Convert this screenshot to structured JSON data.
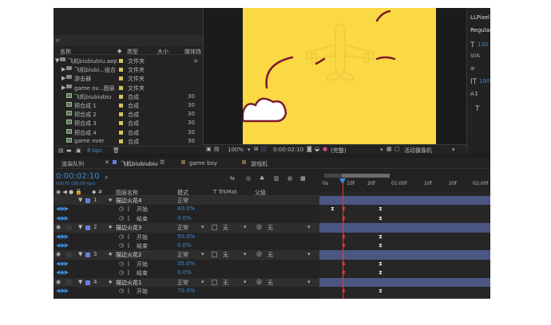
{
  "project": {
    "columns": {
      "name": "名称",
      "type": "类型",
      "size": "大小",
      "media_duration": "媒体持"
    },
    "items": [
      {
        "name": "飞机biubiubiu.aep",
        "type": "文件夹",
        "kind": "folder",
        "expanded": true
      },
      {
        "name": "飞机biubi...组合",
        "type": "文件夹",
        "kind": "folder"
      },
      {
        "name": "游击器",
        "type": "文件夹",
        "kind": "folder"
      },
      {
        "name": "game ov...图层",
        "type": "文件夹",
        "kind": "folder"
      },
      {
        "name": "飞机biubiubiu",
        "type": "合成",
        "kind": "comp",
        "duration": "30"
      },
      {
        "name": "预合成 1",
        "type": "合成",
        "kind": "comp",
        "duration": "30"
      },
      {
        "name": "预合成 2",
        "type": "合成",
        "kind": "comp",
        "duration": "30"
      },
      {
        "name": "预合成 3",
        "type": "合成",
        "kind": "comp",
        "duration": "30"
      },
      {
        "name": "预合成 4",
        "type": "合成",
        "kind": "comp",
        "duration": "30"
      },
      {
        "name": "game over",
        "type": "合成",
        "kind": "comp",
        "duration": "30"
      }
    ],
    "bpc": "8 bpc"
  },
  "viewer": {
    "zoom": "100%",
    "timecode": "0:00:02:10",
    "resolution": "(完整)",
    "camera": "活动摄像机"
  },
  "right_panel": {
    "font": "LLPixel",
    "style": "Regular",
    "size": "130",
    "leading": "100"
  },
  "tabs": {
    "render_queue": "渲染队列",
    "comp1": "飞机biubiubiu",
    "comp2": "game boy",
    "comp3": "游戏机"
  },
  "timeline": {
    "timecode": "0:00:02:10",
    "frames": "00070 (30.00 fps)",
    "columns": {
      "layer_name": "图层名称",
      "mode": "模式",
      "trkmat": "T  TrkMat",
      "parent": "父级"
    },
    "ruler": [
      "0s",
      "10f",
      "20f",
      "01:00f",
      "10f",
      "20f",
      "02:00f"
    ],
    "rows": [
      {
        "kind": "layer",
        "num": "1",
        "name": "描边火花4",
        "mode": "正常",
        "trk": "",
        "parent": ""
      },
      {
        "kind": "prop",
        "name": "开始",
        "value": "40.0%"
      },
      {
        "kind": "prop",
        "name": "结束",
        "value": "0.0%"
      },
      {
        "kind": "layer",
        "num": "2",
        "name": "描边火花3",
        "mode": "正常",
        "trk": "无",
        "parent": "无"
      },
      {
        "kind": "prop",
        "name": "开始",
        "value": "50.0%"
      },
      {
        "kind": "prop",
        "name": "结束",
        "value": "0.0%"
      },
      {
        "kind": "layer",
        "num": "3",
        "name": "描边火花2",
        "mode": "正常",
        "trk": "无",
        "parent": "无"
      },
      {
        "kind": "prop",
        "name": "开始",
        "value": "35.0%"
      },
      {
        "kind": "prop",
        "name": "结束",
        "value": "0.0%"
      },
      {
        "kind": "layer",
        "num": "4",
        "name": "描边火花1",
        "mode": "正常",
        "trk": "无",
        "parent": "无"
      },
      {
        "kind": "prop",
        "name": "开始",
        "value": "70.0%"
      }
    ]
  },
  "colors": {
    "accent": "#3c8ad8",
    "canvas": "#fbd944",
    "layer_bar": "#4c5683",
    "label": "#6d7ce0",
    "playhead": "#e0403c"
  }
}
